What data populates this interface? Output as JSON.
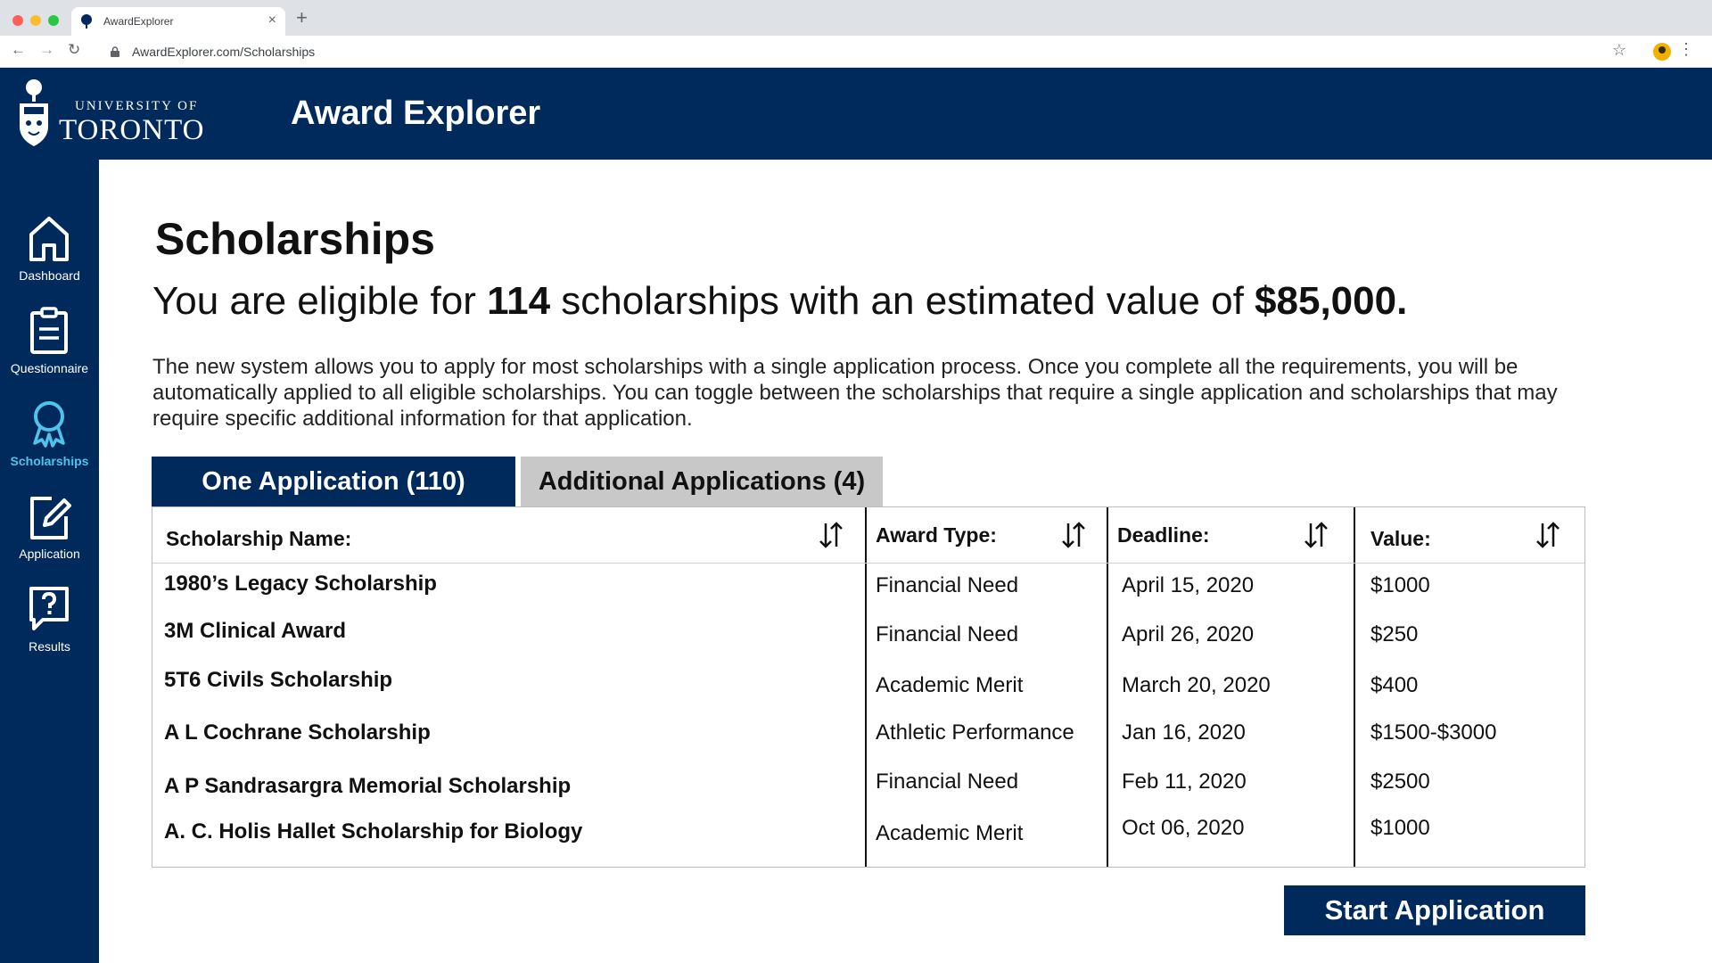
{
  "browser": {
    "tab_title": "AwardExplorer",
    "tab_close": "×",
    "new_tab": "+",
    "url": "AwardExplorer.com/Scholarships",
    "nav_back": "←",
    "nav_forward": "→",
    "nav_reload": "↻",
    "star": "☆",
    "menu": "⋮"
  },
  "header": {
    "university_line1": "UNIVERSITY OF",
    "university_line2": "TORONTO",
    "app_title": "Award Explorer"
  },
  "sidebar": {
    "items": [
      {
        "label": "Dashboard",
        "icon": "home-icon"
      },
      {
        "label": "Questionnaire",
        "icon": "clipboard-icon"
      },
      {
        "label": "Scholarships",
        "icon": "award-icon",
        "active": true
      },
      {
        "label": "Application",
        "icon": "edit-icon"
      },
      {
        "label": "Results",
        "icon": "help-chat-icon"
      }
    ]
  },
  "main": {
    "title": "Scholarships",
    "eligible_prefix": "You are eligible for ",
    "eligible_count": "114",
    "eligible_middle": " scholarships with an estimated value of ",
    "eligible_value": "$85,000.",
    "description": "The new system allows you to apply for most scholarships with a single application process. Once you complete all the requirements, you will be automatically applied to all eligible scholarships. You can toggle between the scholarships that require a single application and scholarships that may require specific additional information for that application.",
    "tabs": [
      {
        "label": "One Application (110)",
        "active": true
      },
      {
        "label": "Additional Applications (4)",
        "active": false
      }
    ],
    "table": {
      "headers": [
        "Scholarship Name:",
        "Award Type:",
        "Deadline:",
        "Value:"
      ],
      "rows": [
        [
          "1980’s Legacy Scholarship",
          "Financial Need",
          "April 15, 2020",
          "$1000"
        ],
        [
          "3M Clinical Award",
          "Financial Need",
          "April 26, 2020",
          "$250"
        ],
        [
          "5T6 Civils Scholarship",
          "Academic Merit",
          "March 20, 2020",
          "$400"
        ],
        [
          "A L Cochrane Scholarship",
          "Athletic Performance",
          "Jan 16, 2020",
          "$1500-$3000"
        ],
        [
          "A P Sandrasargra Memorial Scholarship",
          "Financial Need",
          "Feb 11, 2020",
          "$2500"
        ],
        [
          "A. C. Holis Hallet Scholarship for Biology",
          "Academic Merit",
          "Oct 06, 2020",
          "$1000"
        ]
      ]
    },
    "start_button": "Start Application"
  },
  "colors": {
    "brand_navy": "#002a5c",
    "active_accent": "#4fc3ea",
    "inactive_tab": "#c8c8c8"
  }
}
